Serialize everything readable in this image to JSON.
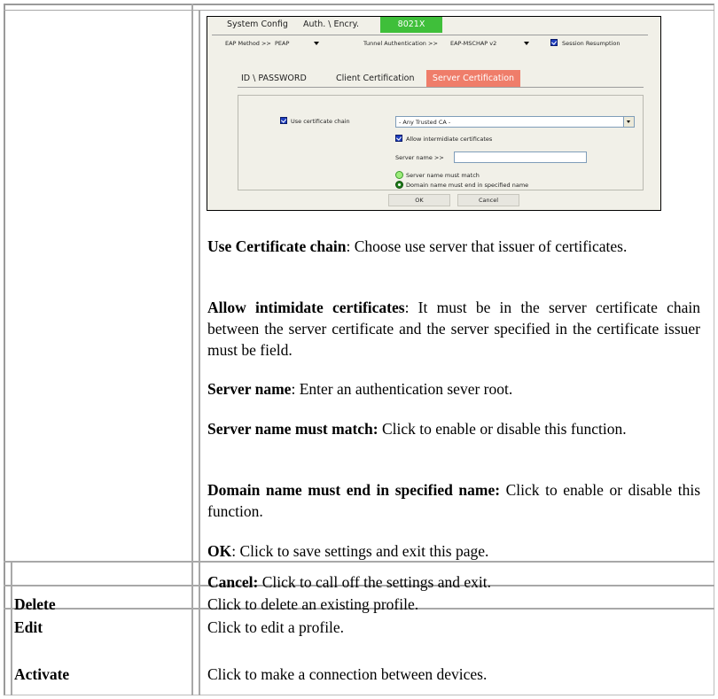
{
  "dialog": {
    "top_tabs": [
      "System Config",
      "Auth. \\ Encry.",
      "8021X"
    ],
    "eap_method_label": "EAP Method >>",
    "eap_method_value": "PEAP",
    "tunnel_auth_label": "Tunnel Authentication >>",
    "tunnel_auth_value": "EAP-MSCHAP v2",
    "session_resumption_label": "Session Resumption",
    "sub_tabs": [
      "ID \\ PASSWORD",
      "Client Certification",
      "Server Certification"
    ],
    "use_cert_chain_label": "Use certificate chain",
    "ca_select_value": "- Any Trusted CA -",
    "allow_intermediate_label": "Allow intermidiate certificates",
    "server_name_label": "Server name >>",
    "server_name_value": "",
    "radio_must_match_label": "Server name must match",
    "radio_domain_label": "Domain name must end in specified name",
    "ok_label": "OK",
    "cancel_label": "Cancel"
  },
  "descriptions": [
    {
      "term": "Use Certificate chain",
      "sep": ": ",
      "text": "Choose use server that issuer of certificates."
    },
    {
      "term": "Allow intimidate certificates",
      "sep": ": ",
      "text": "It must be in the server certificate chain between the server certificate and the server specified in the certificate issuer must be field."
    },
    {
      "term": "Server name",
      "sep": ": ",
      "text": "Enter an authentication sever root."
    },
    {
      "term": "Server name must match:",
      "sep": " ",
      "text": "Click to enable or disable this function."
    },
    {
      "term": "Domain name must end in specified name:",
      "sep": " ",
      "text": "Click to enable or disable this function."
    },
    {
      "term": "OK",
      "sep": ": ",
      "text": "Click to save settings and exit this page."
    },
    {
      "term": "Cancel:",
      "sep": " ",
      "text": "Click to call off the settings and exit."
    }
  ],
  "rows": [
    {
      "label": "Delete",
      "desc": "Click to delete an existing profile."
    },
    {
      "label": "Edit",
      "desc": "Click to edit a profile."
    },
    {
      "label": "Activate",
      "desc": "Click to make a connection between devices."
    }
  ]
}
